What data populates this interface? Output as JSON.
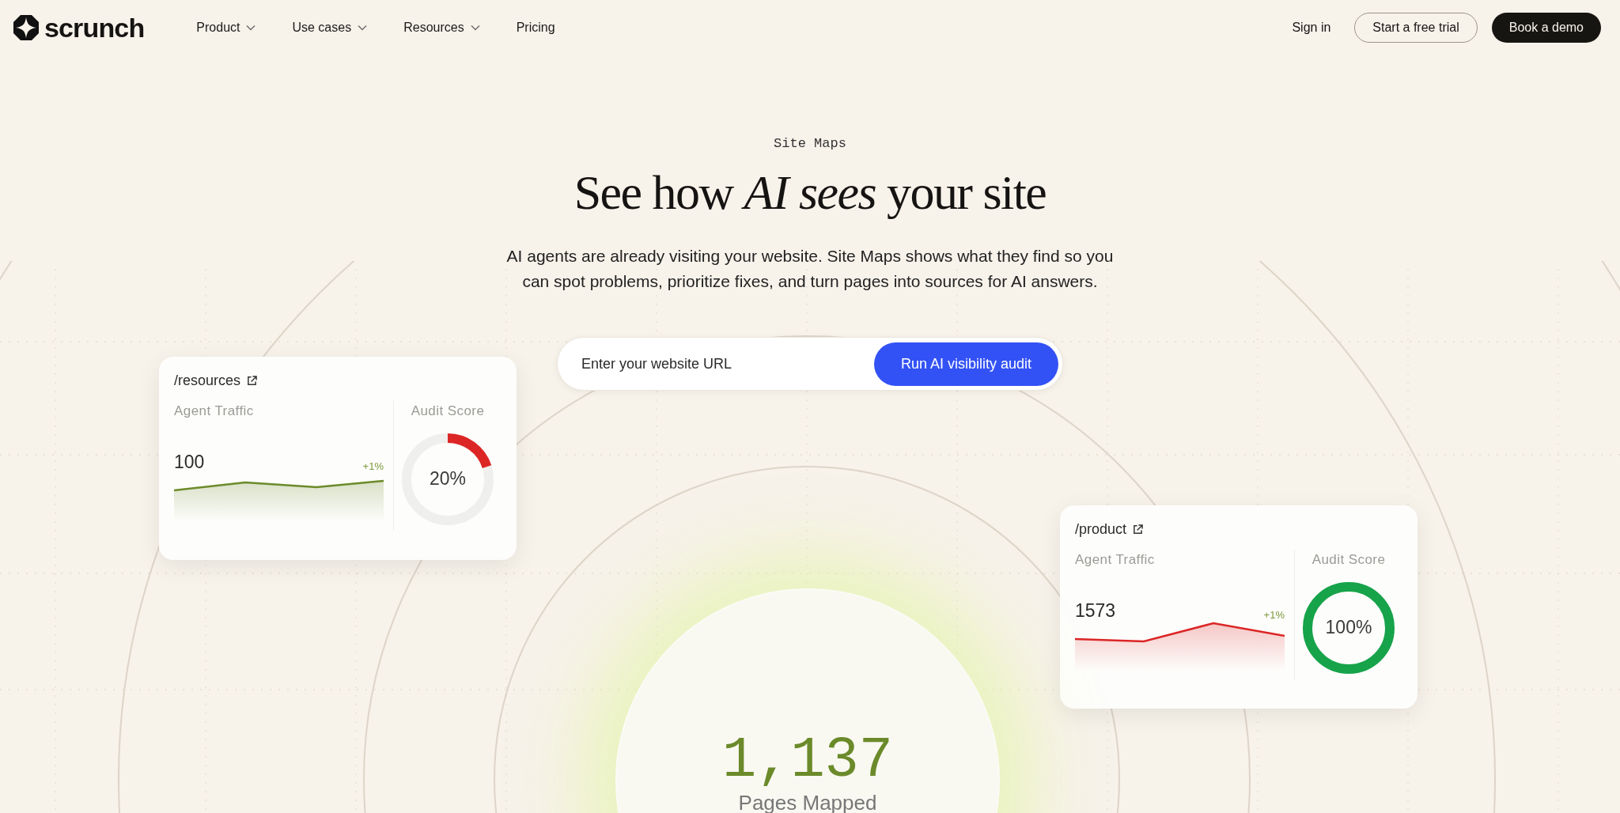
{
  "nav": {
    "brand": "scrunch",
    "links": [
      {
        "label": "Product",
        "dropdown": true
      },
      {
        "label": "Use cases",
        "dropdown": true
      },
      {
        "label": "Resources",
        "dropdown": true
      },
      {
        "label": "Pricing",
        "dropdown": false
      }
    ],
    "sign_in": "Sign in",
    "trial_button": "Start a free trial",
    "demo_button": "Book a demo"
  },
  "hero": {
    "eyebrow": "Site Maps",
    "heading_before": "See how",
    "heading_italic": "AI sees",
    "heading_after": "your site",
    "description": "AI agents are already visiting your website. Site Maps shows what they find so you can spot problems, prioritize fixes, and turn pages into sources for AI answers.",
    "url_field": {
      "placeholder": "Enter your website URL"
    },
    "audit_button": "Run AI visibility audit"
  },
  "cards": [
    {
      "path": "/resources",
      "traffic": {
        "label": "Agent Traffic",
        "value": "100",
        "delta": "+1%",
        "color": "#6b8a2a"
      },
      "score": {
        "label": "Audit Score",
        "text": "20%",
        "level": 0.2,
        "color": "#dc2626"
      }
    },
    {
      "path": "/product",
      "traffic": {
        "label": "Agent Traffic",
        "value": "1573",
        "delta": "+1%",
        "color": "#dc2626"
      },
      "score": {
        "label": "Audit Score",
        "text": "100%",
        "level": 1,
        "color": "#16a34a"
      }
    }
  ],
  "stat": {
    "value": "1,137",
    "label": "Pages Mapped"
  }
}
